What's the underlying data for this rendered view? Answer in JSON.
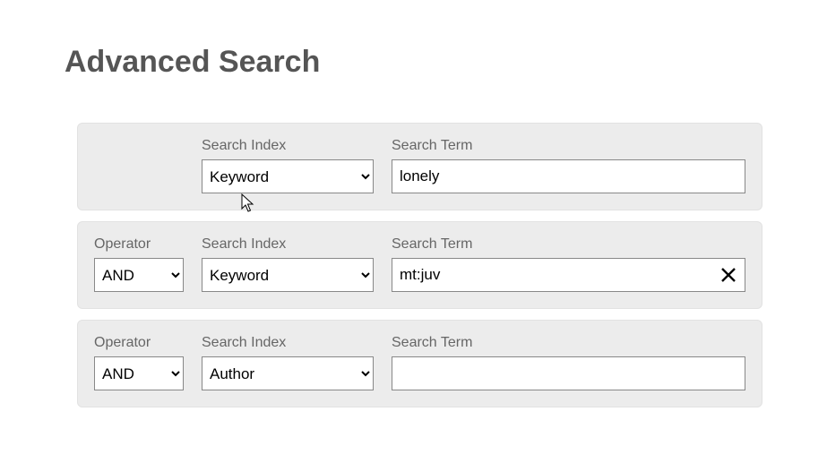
{
  "title": "Advanced Search",
  "labels": {
    "operator": "Operator",
    "search_index": "Search Index",
    "search_term": "Search Term"
  },
  "rows": [
    {
      "has_operator": false,
      "operator": null,
      "index": "Keyword",
      "term": "lonely",
      "show_clear": false
    },
    {
      "has_operator": true,
      "operator": "AND",
      "index": "Keyword",
      "term": "mt:juv",
      "show_clear": true
    },
    {
      "has_operator": true,
      "operator": "AND",
      "index": "Author",
      "term": "",
      "show_clear": false
    }
  ],
  "options": {
    "operator": [
      "AND"
    ],
    "index": [
      "Keyword",
      "Author"
    ]
  }
}
